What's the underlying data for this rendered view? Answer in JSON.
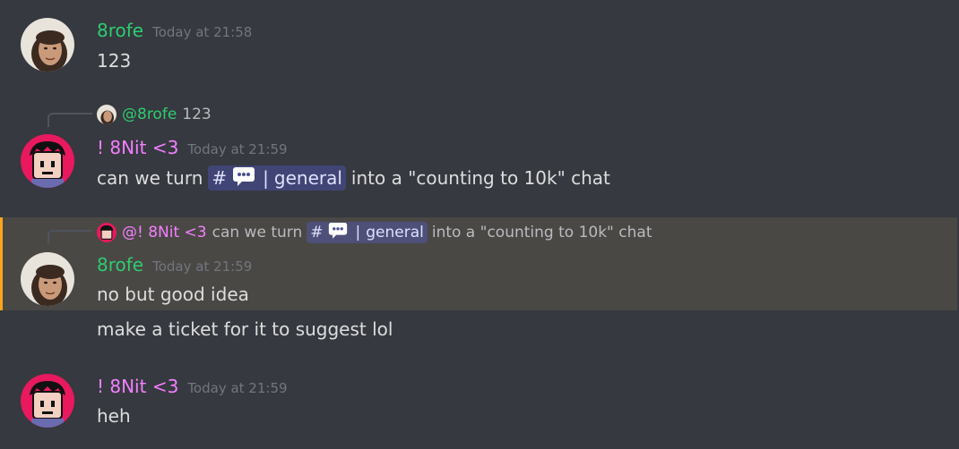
{
  "messages": [
    {
      "author": "8rofe",
      "timestamp": "Today at 21:58",
      "text": "123"
    },
    {
      "reply": {
        "author": "@8rofe",
        "text": "123"
      },
      "author": "! 8Nit <3",
      "timestamp": "Today at 21:59",
      "text_before": "can we turn",
      "channel_mention": "general",
      "text_after": "into a \"counting to 10k\" chat"
    },
    {
      "reply": {
        "author": "@! 8Nit <3",
        "text_before": "can we turn",
        "channel_mention": "general",
        "text_after": "into a \"counting to 10k\" chat"
      },
      "author": "8rofe",
      "timestamp": "Today at 21:59",
      "text": "no but good idea",
      "followup": "make a ticket for it to suggest lol"
    },
    {
      "author": "! 8Nit <3",
      "timestamp": "Today at 21:59",
      "text": "heh"
    }
  ],
  "colors": {
    "background": "#36393f",
    "highlight": "#4a4845",
    "highlight_border": "#faa61a",
    "user_8rofe": "#2ecc71",
    "user_8nit": "#f47fff",
    "mention_bg": "#4b518f"
  },
  "icons": {
    "channel": "hash-icon",
    "chat": "speech-bubble-icon"
  }
}
